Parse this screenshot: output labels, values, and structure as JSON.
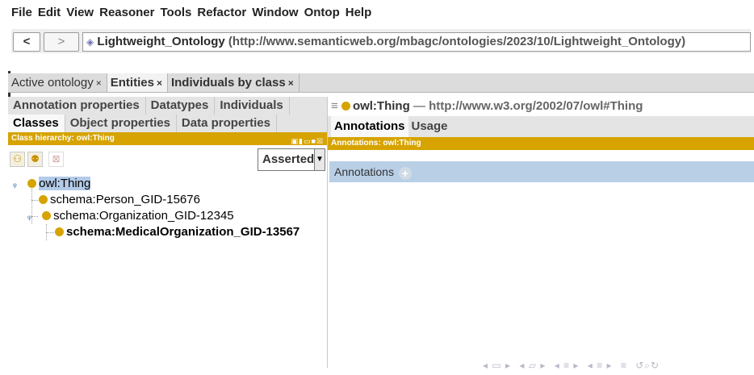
{
  "menu": [
    "File",
    "Edit",
    "View",
    "Reasoner",
    "Tools",
    "Refactor",
    "Window",
    "Ontop",
    "Help"
  ],
  "nav": {
    "back_label": "<",
    "forward_label": ">"
  },
  "ontology": {
    "name": "Lightweight_Ontology",
    "iri": "(http://www.semanticweb.org/mbagc/ontologies/2023/10/Lightweight_Ontology)"
  },
  "workspace_tabs": [
    {
      "label": "Active ontology",
      "close": "×"
    },
    {
      "label": "Entities",
      "close": "×"
    },
    {
      "label": "Individuals by class",
      "close": "×"
    }
  ],
  "view_tabs": {
    "row1": [
      "Annotation properties",
      "Datatypes",
      "Individuals"
    ],
    "row2": [
      "Classes",
      "Object properties",
      "Data properties"
    ]
  },
  "class_hierarchy": {
    "header": "Class hierarchy: owl:Thing",
    "mode": "Asserted",
    "tree": [
      {
        "label": "owl:Thing"
      },
      {
        "label": "schema:Person_GID-15676"
      },
      {
        "label": "schema:Organization_GID-12345"
      },
      {
        "label": "schema:MedicalOrganization_GID-13567"
      }
    ]
  },
  "entity": {
    "name": "owl:Thing",
    "separator": "—",
    "iri": "http://www.w3.org/2002/07/owl#Thing"
  },
  "entity_tabs": [
    "Annotations",
    "Usage"
  ],
  "annotations": {
    "header": "Annotations: owl:Thing",
    "section_label": "Annotations"
  },
  "colors": {
    "accent": "#d6a300",
    "selection": "#b3cbe8",
    "annotation_bar": "#b8cfe6"
  },
  "icons": [
    "add-subclass-icon",
    "add-sibling-icon",
    "delete-class-icon",
    "class-icon",
    "expand-icon",
    "add-icon",
    "menu-icon",
    "ontology-icon"
  ]
}
